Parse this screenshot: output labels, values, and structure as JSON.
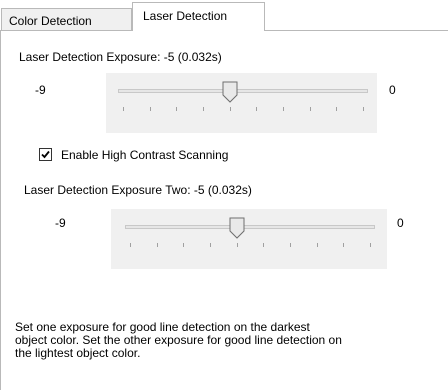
{
  "tabs": [
    {
      "label": "Color Detection",
      "selected": false
    },
    {
      "label": "Laser Detection",
      "selected": true
    }
  ],
  "exposure1": {
    "label": "Laser Detection Exposure:  -5 (0.032s)",
    "min_label": "-9",
    "max_label": "0",
    "min": -9,
    "max": 0,
    "value": -5
  },
  "high_contrast": {
    "label": "Enable High Contrast Scanning",
    "checked": true
  },
  "exposure2": {
    "label": "Laser Detection Exposure Two:  -5 (0.032s)",
    "min_label": "-9",
    "max_label": "0",
    "min": -9,
    "max": 0,
    "value": -5
  },
  "description": {
    "line1": "Set one exposure for good line detection on the darkest",
    "line2": "object color. Set the other exposure for good line detection on",
    "line3": "the lightest object color."
  }
}
